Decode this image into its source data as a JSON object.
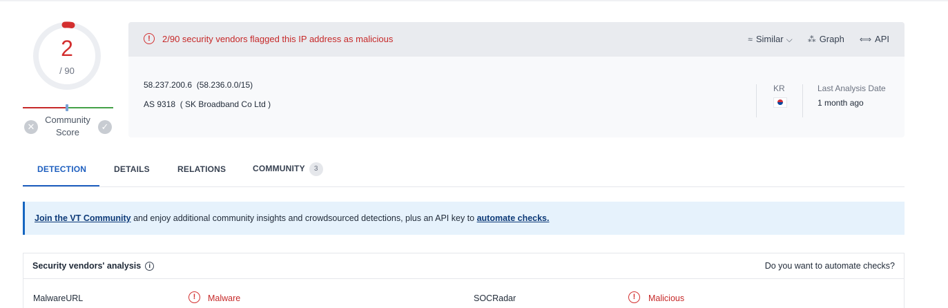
{
  "score": {
    "detected": "2",
    "total": "/ 90",
    "community_label_1": "Community",
    "community_label_2": "Score"
  },
  "summary": {
    "alert": "2/90 security vendors flagged this IP address as malicious",
    "actions": {
      "similar": "Similar",
      "graph": "Graph",
      "api": "API"
    },
    "ip": "58.237.200.6",
    "network": "(58.236.0.0/15)",
    "as_line": "AS 9318  ( SK Broadband Co Ltd )",
    "country": "KR",
    "last_analysis_label": "Last Analysis Date",
    "last_analysis_value": "1 month ago"
  },
  "tabs": {
    "detection": "DETECTION",
    "details": "DETAILS",
    "relations": "RELATIONS",
    "community": "COMMUNITY",
    "community_count": "3"
  },
  "banner": {
    "link1": "Join the VT Community",
    "middle": " and enjoy additional community insights and crowdsourced detections, plus an API key to ",
    "link2": "automate checks."
  },
  "vendors": {
    "title": "Security vendors' analysis",
    "automate_question": "Do you want to automate checks?",
    "rows": [
      {
        "name": "MalwareURL",
        "result": "Malware",
        "name2": "SOCRadar",
        "result2": "Malicious"
      }
    ]
  },
  "colors": {
    "malicious": "#c62828",
    "accent": "#1e5fbf",
    "banner_bg": "#e6f2fc"
  }
}
